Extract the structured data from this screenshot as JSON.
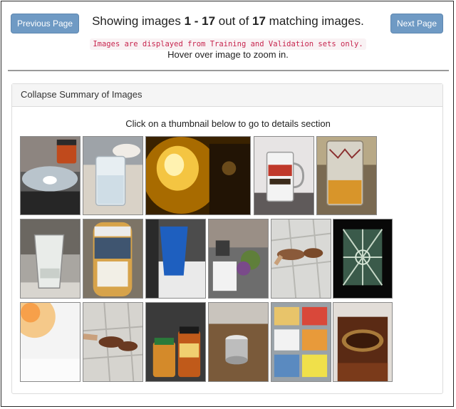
{
  "nav": {
    "previous_label": "Previous Page",
    "next_label": "Next Page"
  },
  "header": {
    "showing_prefix": "Showing images ",
    "range": "1 - 17",
    "out_of": " out of ",
    "total": "17",
    "suffix": " matching images.",
    "notice": "Images are displayed from Training and Validation sets only.",
    "hover_hint": "Hover over image to zoom in."
  },
  "summary": {
    "collapse_label": "Collapse Summary of Images",
    "click_hint": "Click on a thumbnail below to go to details section"
  },
  "thumbnails": [
    {
      "subject": "spice bottle on dark counter"
    },
    {
      "subject": "glass of water on table"
    },
    {
      "subject": "wine glass lit by warm light"
    },
    {
      "subject": "beer mug with horse decal"
    },
    {
      "subject": "glass with amber liquid"
    },
    {
      "subject": "empty drinking glass on counter"
    },
    {
      "subject": "caramel sauce bottle"
    },
    {
      "subject": "blue cup on appliance"
    },
    {
      "subject": "cluttered room with box"
    },
    {
      "subject": "sunglasses held over tiled floor"
    },
    {
      "subject": "stained glass window"
    },
    {
      "subject": "overexposed bright blur"
    },
    {
      "subject": "hand holding sunglasses over tiles"
    },
    {
      "subject": "jars and bottles on shelf"
    },
    {
      "subject": "metal cup on wooden table"
    },
    {
      "subject": "frozen food boxes in freezer"
    },
    {
      "subject": "wooden bread box"
    }
  ],
  "colors": {
    "button": "#6f9ac4",
    "notice_text": "#c7254e",
    "notice_bg": "#f9f2f4"
  }
}
